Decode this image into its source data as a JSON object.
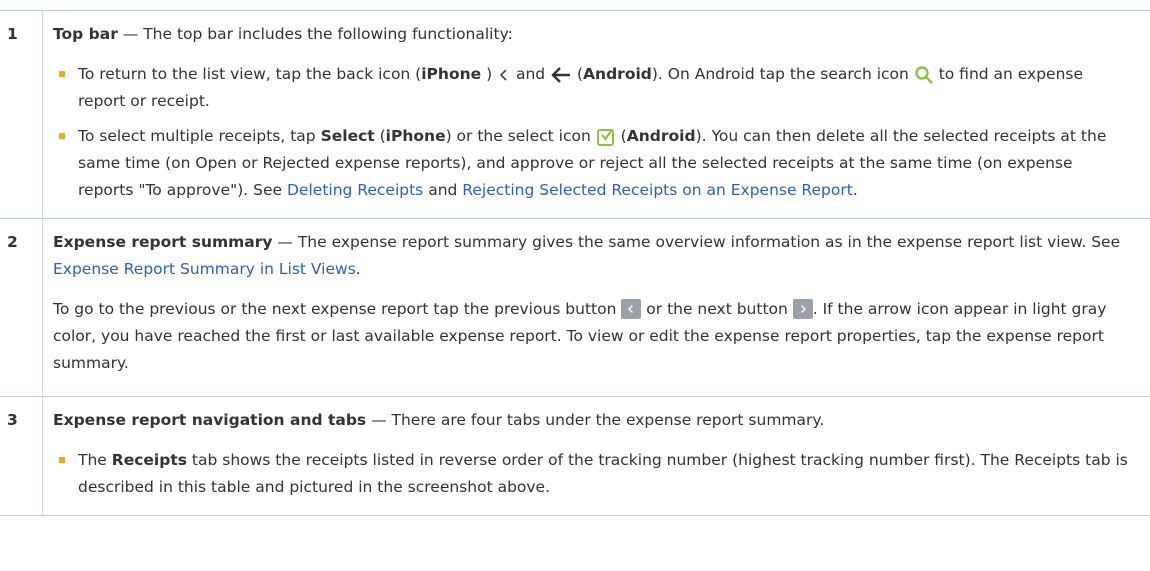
{
  "rows": [
    {
      "num": "1",
      "title": "Top bar",
      "intro": " — The top bar includes the following functionality:",
      "b1": {
        "t1": "To return to the list view, tap the back icon (",
        "iphone": "iPhone",
        "t2": " ) ",
        "t3": " and ",
        "t4": " (",
        "android": "Android",
        "t5": "). On Android tap the search icon ",
        "t6": " to find an expense report or receipt."
      },
      "b2": {
        "t1": "To select multiple receipts, tap ",
        "select": "Select",
        "t2": " (",
        "iphone": "iPhone",
        "t3": ") or the select icon ",
        "t4": " (",
        "android": "Android",
        "t5": "). You can then delete all the selected receipts at the same time (on Open or Rejected expense reports), and approve or reject all the selected receipts at the same time (on expense reports \"To approve\"). See ",
        "link1": "Deleting Receipts",
        "t6": " and ",
        "link2": "Rejecting Selected Receipts on an Expense Report",
        "t7": "."
      }
    },
    {
      "num": "2",
      "title": "Expense report summary",
      "intro": " — The expense report summary gives the same overview information as in the expense report list view. See ",
      "link": "Expense Report Summary in List Views",
      "intro_end": ".",
      "p2": {
        "t1": "To go to the previous or the next expense report tap the previous button ",
        "t2": " or the next button ",
        "t3": ". If the arrow icon appear in light gray color, you have reached the first or last available expense report. To view or edit the expense report properties, tap the expense report summary."
      }
    },
    {
      "num": "3",
      "title": "Expense report navigation and tabs",
      "intro": " — There are four tabs under the expense report summary.",
      "b1": {
        "t1": "The ",
        "receipts": "Receipts",
        "t2": " tab shows the receipts listed in reverse order of the tracking number (highest tracking number first). The Receipts tab is described in this table and pictured in the screenshot above."
      }
    }
  ],
  "colors": {
    "link": "#2b5fc0",
    "bullet": "#f5a623",
    "icon_green": "#8bc34a",
    "rule": "#b9c9e3"
  },
  "icons": [
    "back-chevron-icon",
    "back-arrow-icon",
    "search-icon",
    "select-icon",
    "previous-button-icon",
    "next-button-icon"
  ]
}
